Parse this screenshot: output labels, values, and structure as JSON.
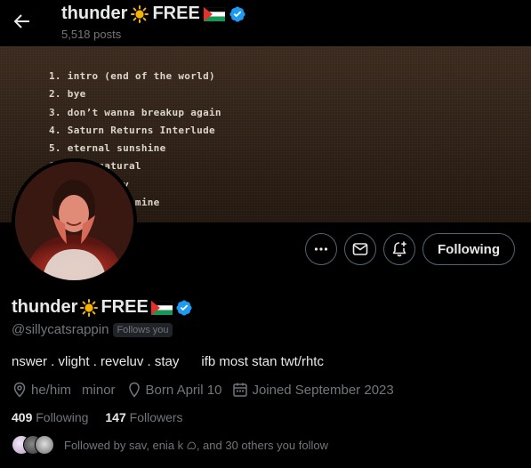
{
  "header": {
    "name": "thunder",
    "name_suffix": "FREE",
    "posts_count": "5,518 posts"
  },
  "banner": {
    "tracks": [
      "1. intro (end of the world)",
      "2. bye",
      "3. don’t wanna breakup again",
      "4. Saturn Returns Interlude",
      "5. eternal sunshine",
      "6. supernatural",
      "7. true story",
      "8. the boy is mine"
    ]
  },
  "actions": {
    "following_label": "Following"
  },
  "profile": {
    "name": "thunder",
    "name_suffix": "FREE",
    "handle": "@sillycatsrappin",
    "follows_you": "Follows you",
    "bio": "nswer . vlight . reveluv . stay      ifb most stan twt/rhtc",
    "pronouns": "he/him",
    "location": "minor",
    "birthday": "Born April 10",
    "joined": "Joined September 2023",
    "following_count": "409",
    "following_label": "Following",
    "followers_count": "147",
    "followers_label": "Followers",
    "followed_by": "Followed by sav, enia k ᜊ, and 30 others you follow"
  },
  "colors": {
    "verified": "#1d9bf0",
    "muted": "#71767b",
    "text": "#e7e9ea",
    "sun": "#f4b400"
  },
  "icons": [
    "back-arrow-icon",
    "sun-emoji-icon",
    "palestine-flag-icon",
    "verified-badge-icon",
    "more-icon",
    "message-icon",
    "notify-icon",
    "pronouns-icon",
    "location-icon",
    "calendar-icon"
  ]
}
